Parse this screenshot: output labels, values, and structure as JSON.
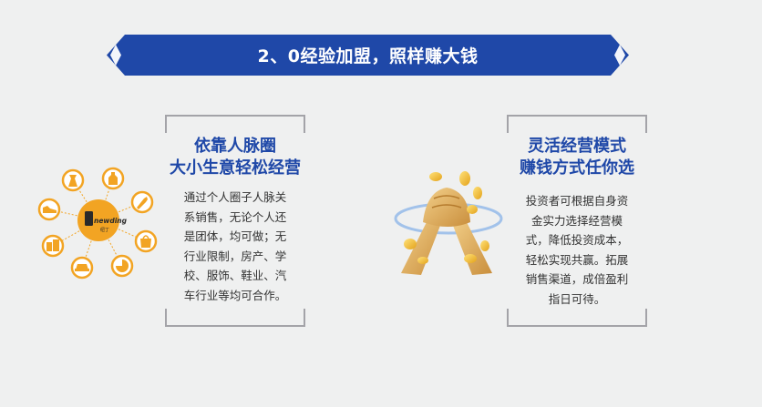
{
  "banner": {
    "title": "2、0经验加盟，照样赚大钱",
    "color": "#1f48a8"
  },
  "left_card": {
    "heading_line1": "依靠人脉圈",
    "heading_line2": "大小生意轻松经营",
    "description_lines": [
      "通过个人圈子人脉关",
      "系销售，无论个人还",
      "是团体，均可做；无",
      "行业限制，房产、学",
      "校、服饰、鞋业、汽",
      "车行业等均可合作。"
    ],
    "logo_text": "newding",
    "logo_subtext": "纽丁"
  },
  "right_card": {
    "heading_line1": "灵活经营模式",
    "heading_line2": "赚钱方式任你选",
    "description_lines": [
      "投资者可根据自身资",
      "金实力选择经营模",
      "式，降低投资成本，",
      "轻松实现共赢。拓展",
      "销售渠道，成倍盈利",
      "指日可待。"
    ]
  },
  "colors": {
    "heading": "#1f48a8",
    "bracket": "#a3a3a8",
    "accent_orange": "#f2a423",
    "background": "#eff0f0"
  },
  "icons": [
    "dress-icon",
    "bottle-icon",
    "tools-icon",
    "shoe-icon",
    "building-icon",
    "bag-icon",
    "car-icon",
    "pie-icon",
    "hands-coins-icon"
  ]
}
